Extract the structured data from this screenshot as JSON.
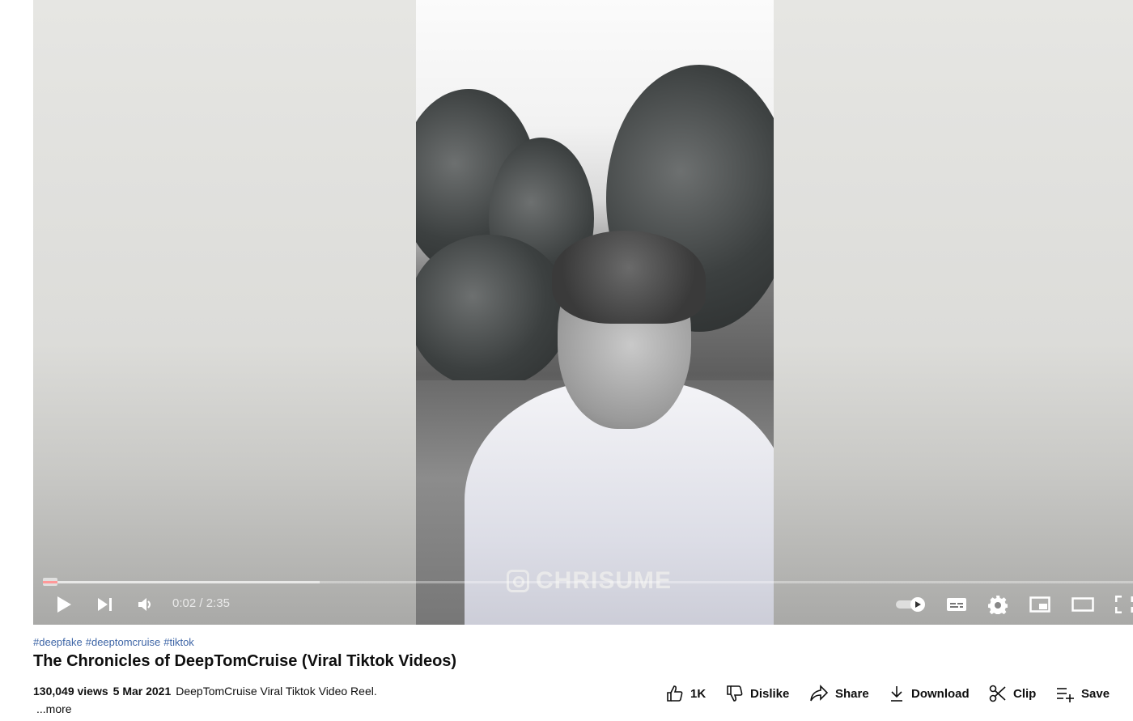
{
  "player": {
    "watermark": "CHRISUME",
    "time": {
      "current": "0:02",
      "separator": " / ",
      "duration": "2:35"
    },
    "progress_fraction": 0.013,
    "buffered_fraction": 0.254,
    "autoplay_on": true,
    "controls": [
      "play-icon",
      "next-icon",
      "volume-icon",
      "autoplay-toggle",
      "subtitles-icon",
      "settings-icon",
      "miniplayer-icon",
      "theater-icon",
      "fullscreen-icon"
    ]
  },
  "video": {
    "hashtags": [
      "#deepfake",
      "#deeptomcruise",
      "#tiktok"
    ],
    "title": "The Chronicles of DeepTomCruise (Viral Tiktok Videos)",
    "views": "130,049 views",
    "date": "5 Mar 2021",
    "description": "DeepTomCruise Viral Tiktok Video Reel.",
    "more_label": "...more"
  },
  "actions": {
    "like_count": "1K",
    "dislike": "Dislike",
    "share": "Share",
    "download": "Download",
    "clip": "Clip",
    "save": "Save"
  }
}
